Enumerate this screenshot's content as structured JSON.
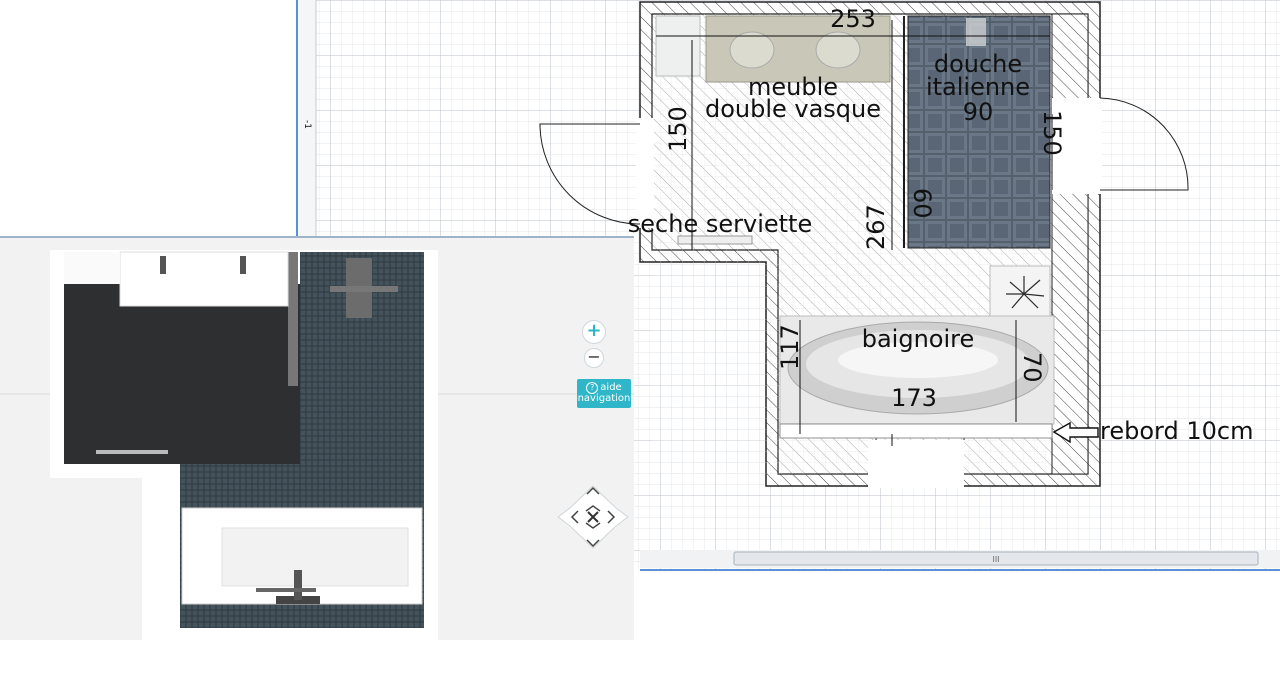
{
  "plan": {
    "ruler_mark": "-1",
    "labels": {
      "width_top": "253",
      "vanity_line1": "meuble",
      "vanity_line2": "double vasque",
      "shower_line1": "douche",
      "shower_line2": "italienne",
      "shower_width": "90",
      "left_depth": "150",
      "right_door": "150",
      "shower_depth": "60",
      "towel_dryer": "seche serviette",
      "total_length": "267",
      "bathtub": "baignoire",
      "bath_depth": "117",
      "bath_side": "70",
      "bath_length": "173",
      "ledge": "rebord 10cm"
    },
    "scrollbar_grip": "III"
  },
  "view3d": {
    "zoom_in": "+",
    "zoom_out": "−",
    "help_line1": "aide",
    "help_line2": "navigation"
  },
  "colors": {
    "grid": "#cfd6dc",
    "wall_hatch": "#444444",
    "shower_tile": "#5d6a78",
    "floor_dark": "#2e2f31",
    "mosaic": "#3b4950",
    "accent": "#2fb7c9",
    "ruler_blue": "#5b8fd6"
  }
}
